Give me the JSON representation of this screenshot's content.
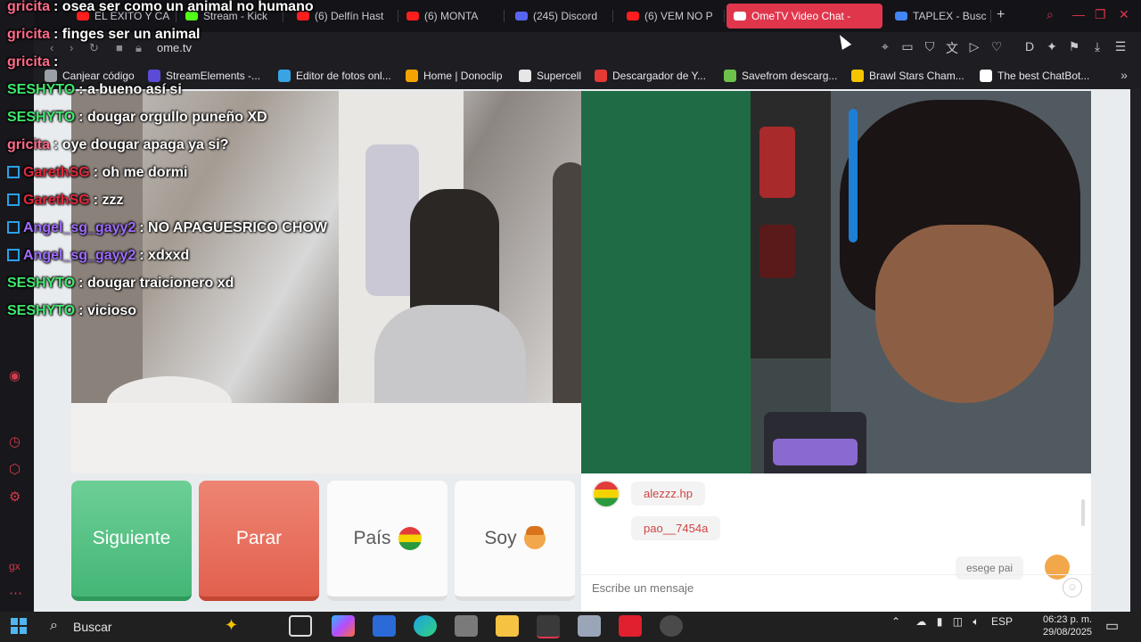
{
  "browser": {
    "tabs": [
      {
        "label": "EL EXITO Y CA",
        "icon_color": "#ff1e1e"
      },
      {
        "label": "Stream - Kick",
        "icon_color": "#53fc18"
      },
      {
        "label": "(6) Delfín Hast",
        "icon_color": "#ff1e1e"
      },
      {
        "label": "(6) MONTA",
        "icon_color": "#ff1e1e"
      },
      {
        "label": "(245) Discord",
        "icon_color": "#5865f2"
      },
      {
        "label": "(6) VEM NO P",
        "icon_color": "#ff1e1e"
      },
      {
        "label": "OmeTV Video Chat -",
        "icon_color": "#ffffff"
      },
      {
        "label": "TAPLEX - Busc",
        "icon_color": "#4285f4"
      }
    ],
    "url": "ome.tv",
    "bookmarks": [
      {
        "label": "Canjear código",
        "icon_color": "#9aa0a6"
      },
      {
        "label": "StreamElements -...",
        "icon_color": "#5b4bd6"
      },
      {
        "label": "Editor de fotos onl...",
        "icon_color": "#3aa3e3"
      },
      {
        "label": "Home | Donoclip",
        "icon_color": "#f4a300"
      },
      {
        "label": "Supercell",
        "icon_color": "#e6e6e6"
      },
      {
        "label": "Descargador de Y...",
        "icon_color": "#e53935"
      },
      {
        "label": "Savefrom descarg...",
        "icon_color": "#6cc24a"
      },
      {
        "label": "Brawl Stars Cham...",
        "icon_color": "#f5c400"
      },
      {
        "label": "The best ChatBot...",
        "icon_color": "#ffffff"
      }
    ]
  },
  "stream_chat": [
    {
      "user": "gricita",
      "user_color": "#ff6b8a",
      "text": ": osea ser como un animal no humano",
      "badge": false
    },
    {
      "user": "gricita",
      "user_color": "#ff6b8a",
      "text": ": finges ser un animal",
      "badge": false
    },
    {
      "user": "gricita",
      "user_color": "#ff6b8a",
      "text": ":",
      "badge": false
    },
    {
      "user": "SESHYTO",
      "user_color": "#3ee86d",
      "text": ": a bueno así si",
      "badge": false
    },
    {
      "user": "SESHYTO",
      "user_color": "#3ee86d",
      "text": ": dougar orgullo puneño XD",
      "badge": false
    },
    {
      "user": "gricita",
      "user_color": "#ff6b8a",
      "text": ": oye dougar apaga ya si?",
      "badge": false
    },
    {
      "user": "GarethSG",
      "user_color": "#e0283c",
      "text": ": oh me dormi",
      "badge": true
    },
    {
      "user": "GarethSG",
      "user_color": "#e0283c",
      "text": ": zzz",
      "badge": true
    },
    {
      "user": "Angel_sg_gayy2",
      "user_color": "#a06cff",
      "text": ": NO APAGUESRICO CHOW",
      "badge": true
    },
    {
      "user": "Angel_sg_gayy2",
      "user_color": "#a06cff",
      "text": ": xdxxd",
      "badge": true
    },
    {
      "user": "SESHYTO",
      "user_color": "#3ee86d",
      "text": ": dougar traicionero xd",
      "badge": false
    },
    {
      "user": "SESHYTO",
      "user_color": "#3ee86d",
      "text": ": vicioso",
      "badge": false
    }
  ],
  "controls": {
    "next_label": "Siguiente",
    "stop_label": "Parar",
    "country_label": "País",
    "me_label": "Soy"
  },
  "ometv_chat": {
    "messages": [
      "alezzz.hp",
      "pao__7454a"
    ],
    "my_message": "esege pai",
    "input_placeholder": "Escribe un mensaje"
  },
  "taskbar": {
    "search_label": "Buscar",
    "language": "ESP",
    "time": "06:23 p. m.",
    "date": "29/08/2025"
  }
}
